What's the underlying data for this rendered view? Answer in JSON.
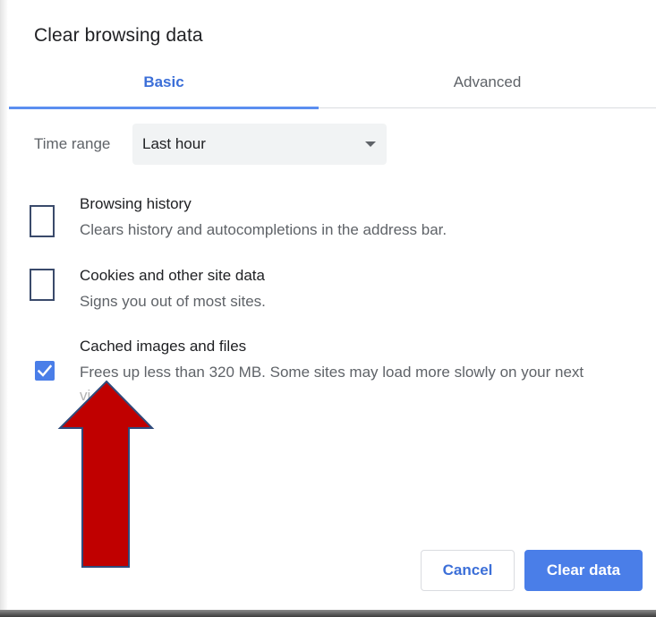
{
  "dialog": {
    "title": "Clear browsing data"
  },
  "tabs": [
    {
      "label": "Basic",
      "active": true
    },
    {
      "label": "Advanced",
      "active": false
    }
  ],
  "time_range": {
    "label": "Time range",
    "selected": "Last hour"
  },
  "options": [
    {
      "title": "Browsing history",
      "description": "Clears history and autocompletions in the address bar.",
      "checked": false
    },
    {
      "title": "Cookies and other site data",
      "description": "Signs you out of most sites.",
      "checked": false
    },
    {
      "title": "Cached images and files",
      "description": "Frees up less than 320 MB. Some sites may load more slowly on your next",
      "description_overflow": "vi",
      "checked": true
    }
  ],
  "buttons": {
    "cancel": "Cancel",
    "clear": "Clear data"
  },
  "colors": {
    "accent": "#4a7ee8",
    "arrow_fill": "#c00000",
    "arrow_stroke": "#2f4b7c"
  }
}
